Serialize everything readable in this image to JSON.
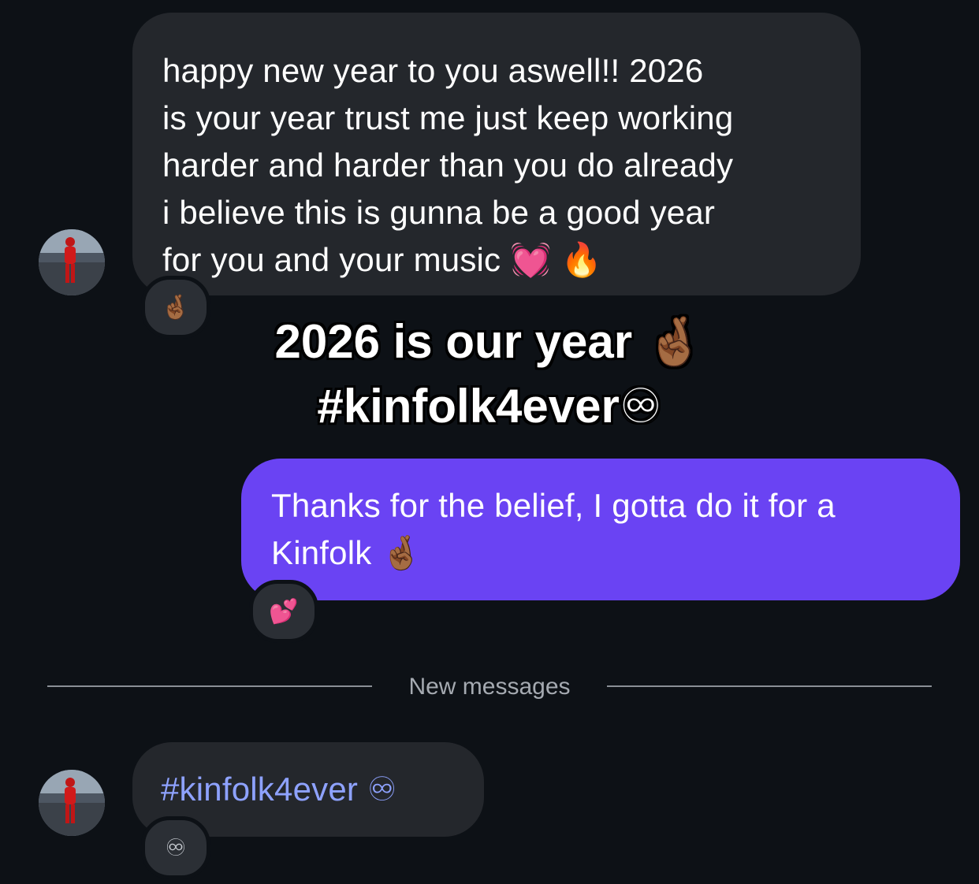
{
  "conversation": {
    "messages": [
      {
        "direction": "incoming",
        "lines": [
          "happy new year to you aswell!! 2026",
          "is your year trust me just keep working",
          "harder and harder than you do already",
          "i believe this is gunna be a good year",
          "for you and your music 💓 🔥"
        ],
        "reaction": "🤞🏾"
      },
      {
        "direction": "outgoing",
        "lines": [
          "Thanks for the belief, I gotta do it for a",
          "Kinfolk 🤞🏾"
        ],
        "reaction": "💕"
      },
      {
        "direction": "incoming",
        "lines": [
          "#kinfolk4ever ♾"
        ],
        "reaction": "♾"
      }
    ]
  },
  "overlay_caption": {
    "line1": "2026 is our year 🤞🏾",
    "line2": "#kinfolk4ever♾"
  },
  "divider": {
    "label": "New messages"
  },
  "colors": {
    "background": "#0d1116",
    "incoming_bubble": "#24272c",
    "outgoing_bubble": "#6a43f3",
    "reaction_pill": "#2b2f35",
    "hashtag": "#8ea2ff",
    "divider_text": "#a5aab1"
  },
  "icons": {
    "avatar": "user-avatar-photo"
  }
}
